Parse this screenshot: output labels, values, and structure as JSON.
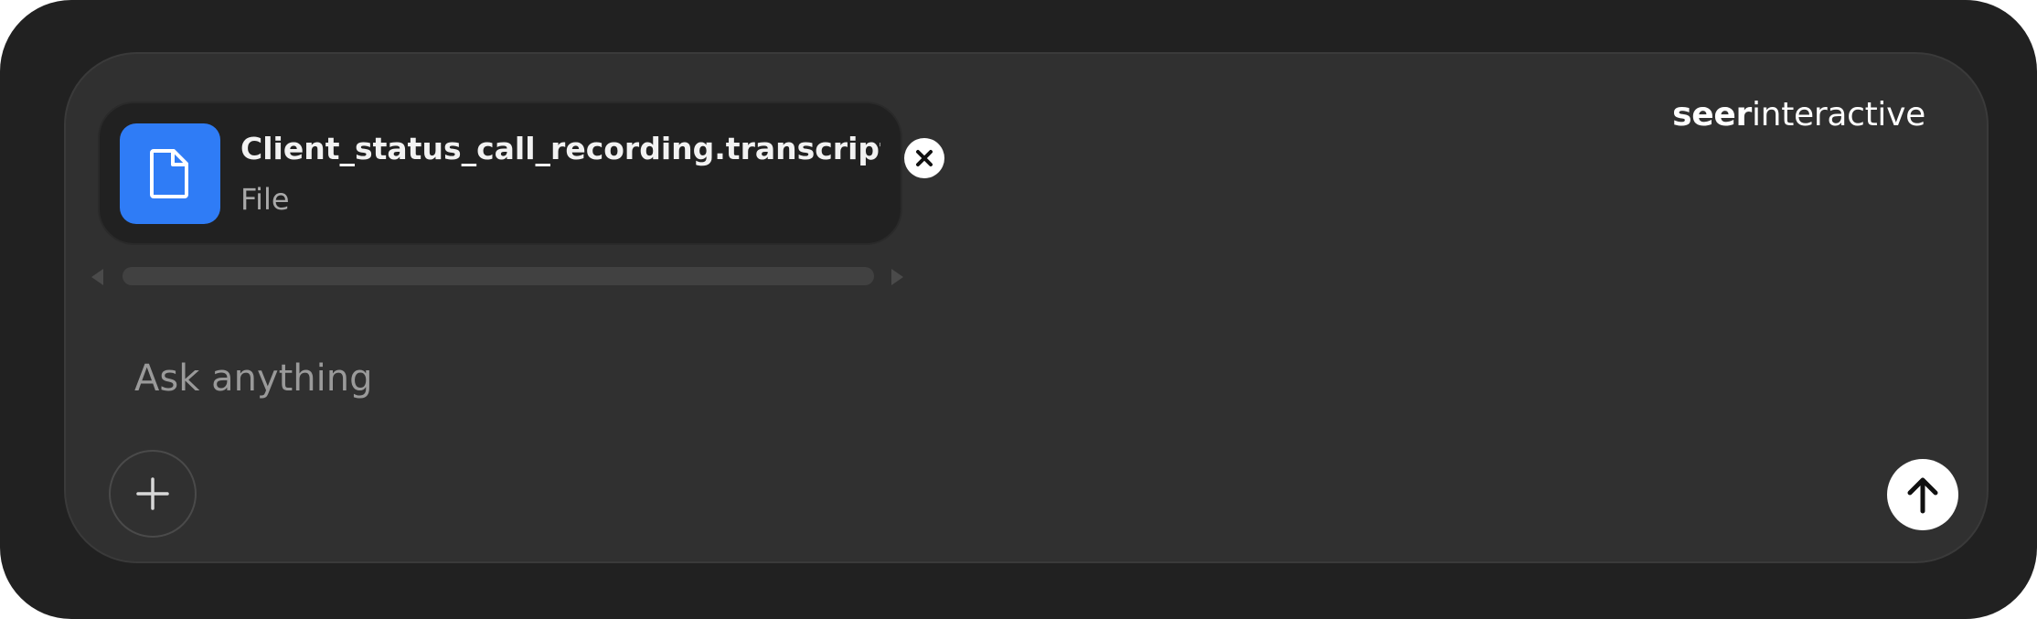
{
  "brand": {
    "bold_text": "seer",
    "light_text": "interactive"
  },
  "attachment": {
    "file_name": "Client_status_call_recording.transcript....",
    "file_type": "File",
    "icon": "file-icon",
    "remove_icon": "close-icon"
  },
  "composer": {
    "placeholder": "Ask anything",
    "value": "",
    "add_icon": "plus-icon",
    "send_icon": "arrow-up-icon"
  },
  "colors": {
    "outer_background": "#212121",
    "composer_background": "#303030",
    "file_icon_tile": "#2f7cf6",
    "send_button": "#ffffff"
  }
}
